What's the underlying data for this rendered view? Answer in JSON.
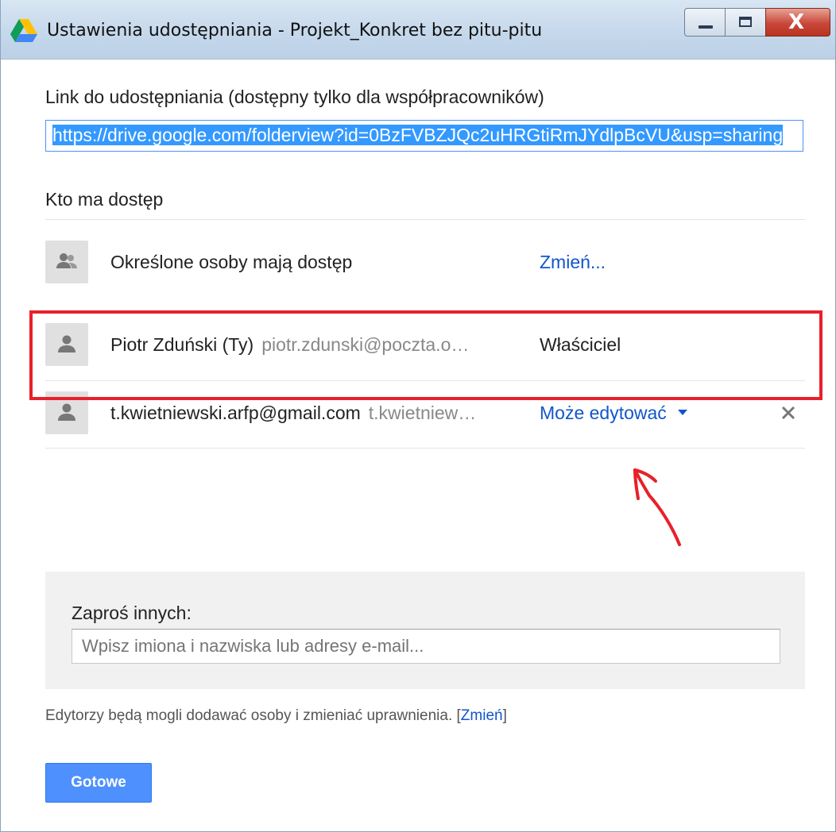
{
  "window": {
    "title": "Ustawienia udostępniania - Projekt_Konkret bez pitu-pitu",
    "app_icon": "google-drive-icon",
    "controls": [
      "minimize-icon",
      "maximize-icon",
      "close-icon"
    ],
    "close_glyph": "X"
  },
  "link_section": {
    "label": "Link do udostępniania (dostępny tylko dla współpracowników)",
    "url": "https://drive.google.com/folderview?id=0BzFVBZJQc2uHRGtiRmJYdlpBcVU&usp=sharing"
  },
  "access": {
    "heading": "Kto ma dostęp",
    "visibility": {
      "icon": "people-icon",
      "label": "Określone osoby mają dostęp",
      "change_link": "Zmień..."
    },
    "people": [
      {
        "icon": "person-icon",
        "name": "Piotr Zduński (Ty)",
        "email": "piotr.zdunski@poczta.o…",
        "role": "Właściciel"
      },
      {
        "icon": "person-icon",
        "name": "t.kwietniewski.arfp@gmail.com",
        "email": "t.kwietniew…",
        "role": "Może edytować",
        "remove_icon": "close-icon"
      }
    ]
  },
  "invite": {
    "label": "Zaproś innych:",
    "placeholder": "Wpisz imiona i nazwiska lub adresy e-mail...",
    "value": ""
  },
  "footnote": {
    "text": "Edytorzy będą mogli dodawać osoby i zmieniać uprawnienia.",
    "bracket_open": "[",
    "link": "Zmień",
    "bracket_close": "]"
  },
  "done_button": "Gotowe",
  "colors": {
    "accent": "#4d90fe",
    "link": "#1155cc",
    "annotation": "#e8202a"
  }
}
